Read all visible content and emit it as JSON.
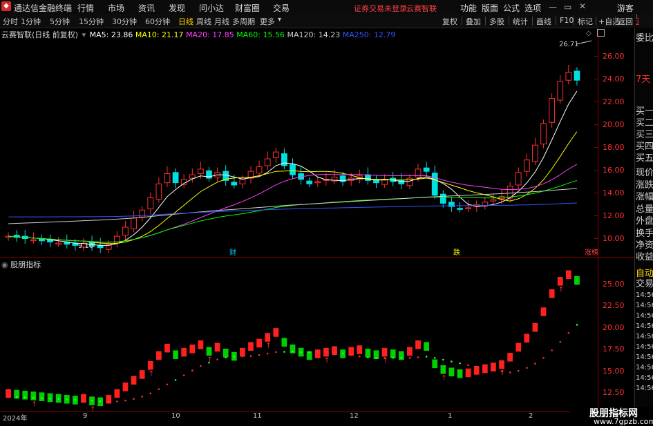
{
  "window": {
    "title": "通达信金融终端"
  },
  "menu": [
    "行情",
    "市场",
    "资讯",
    "发现",
    "问小达",
    "财富圈",
    "交易"
  ],
  "notice": {
    "login_status": "证券交易未登录",
    "stock_name": "云赛智联"
  },
  "titlebar_right": [
    "功能",
    "版面",
    "公式",
    "选项",
    "游客"
  ],
  "periods": [
    "分时",
    "1分钟",
    "5分钟",
    "15分钟",
    "30分钟",
    "60分钟",
    "日线",
    "周线",
    "月线",
    "多周期",
    "更多"
  ],
  "active_period": "日线",
  "tools": [
    "复权",
    "叠加",
    "多股",
    "统计",
    "画线",
    "F10",
    "标记",
    "+自选",
    "返回"
  ],
  "legend": {
    "stock_label": "云赛智联(日线 前复权)",
    "ma": [
      {
        "label": "MA5: 23.86",
        "color": "#ffffff"
      },
      {
        "label": "MA10: 21.17",
        "color": "#ffff00"
      },
      {
        "label": "MA20: 17.85",
        "color": "#ff40ff"
      },
      {
        "label": "MA60: 15.56",
        "color": "#00ff00"
      },
      {
        "label": "MA120: 14.23",
        "color": "#d0d0d0"
      },
      {
        "label": "MA250: 12.79",
        "color": "#3355ff"
      }
    ]
  },
  "main_axis": {
    "ticks": [
      "26.00",
      "24.00",
      "22.00",
      "20.00",
      "18.00",
      "16.00",
      "14.00",
      "12.00",
      "10.00"
    ]
  },
  "main_annotations": {
    "high_price": "26.71",
    "low_price": "9.16",
    "event_cai": "财",
    "event_die": "跌",
    "event_zhangting": "涨榜"
  },
  "sub_indicator": {
    "name": "股朋指标"
  },
  "sub_axis": {
    "ticks": [
      "25.00",
      "22.50",
      "20.00",
      "17.50",
      "15.00",
      "12.50"
    ]
  },
  "right_panel": [
    "委比",
    "7天",
    "买一",
    "买二",
    "买三",
    "买四",
    "买五",
    "现价",
    "涨跌",
    "涨幅",
    "总量",
    "外盘",
    "换手",
    "净资",
    "收益",
    "自动",
    "交易",
    "14:56",
    "14:56",
    "14:56",
    "14:56",
    "14:56",
    "14:56",
    "14:56",
    "14:56",
    "14:56",
    "14:56"
  ],
  "time_axis": [
    "2024年",
    "9",
    "10",
    "11",
    "12",
    "1",
    "2"
  ],
  "watermark": {
    "text": "股朋指标网",
    "url": "www.7gpzb.com"
  },
  "chart_data": {
    "type": "candlestick",
    "title": "云赛智联(日线 前复权)",
    "ylim": [
      9,
      27
    ],
    "x_months": [
      "2024年",
      "9",
      "10",
      "11",
      "12",
      "1",
      "2"
    ],
    "candles_close": [
      10.2,
      10.1,
      10.0,
      9.9,
      9.8,
      9.7,
      9.6,
      9.5,
      9.4,
      9.6,
      9.3,
      9.2,
      9.5,
      10.2,
      11.0,
      11.8,
      12.5,
      13.6,
      14.8,
      15.7,
      14.9,
      15.2,
      15.6,
      16.1,
      15.3,
      15.8,
      15.1,
      14.7,
      15.2,
      15.9,
      16.3,
      17.0,
      17.6,
      16.4,
      15.6,
      15.2,
      14.8,
      15.0,
      15.2,
      15.4,
      15.0,
      15.3,
      15.5,
      15.1,
      14.9,
      15.2,
      15.0,
      14.8,
      15.3,
      16.1,
      15.9,
      13.8,
      13.1,
      12.8,
      12.6,
      12.7,
      13.0,
      13.2,
      13.4,
      13.7,
      14.6,
      15.8,
      16.9,
      18.2,
      20.1,
      22.3,
      23.8,
      24.6,
      23.9
    ],
    "ma_series": [
      {
        "name": "MA5",
        "color": "#ffffff"
      },
      {
        "name": "MA10",
        "color": "#ffff00"
      },
      {
        "name": "MA20",
        "color": "#ff40ff"
      },
      {
        "name": "MA60",
        "color": "#00ff00"
      },
      {
        "name": "MA120",
        "color": "#d0d0d0"
      },
      {
        "name": "MA250",
        "color": "#3355ff"
      }
    ]
  },
  "colors": {
    "up": "#ff3030",
    "down": "#00e0e0",
    "bg": "#000000",
    "axis_red": "#8b0000",
    "accent_yellow": "#ffd200"
  }
}
